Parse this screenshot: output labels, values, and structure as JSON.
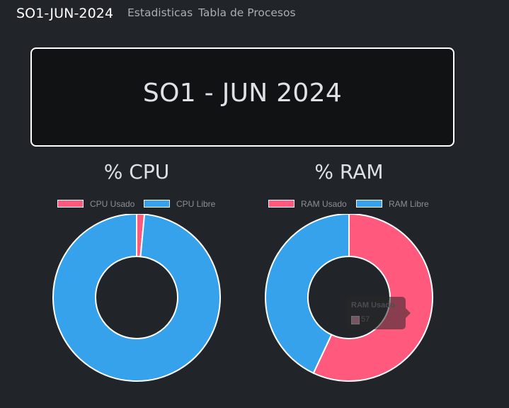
{
  "nav": {
    "brand": "SO1-JUN-2024",
    "links": [
      "Estadisticas",
      "Tabla de Procesos"
    ]
  },
  "banner": {
    "title": "SO1 - JUN 2024"
  },
  "colors": {
    "used": "#ff5a7e",
    "free": "#36a2eb",
    "background": "#212529"
  },
  "chart_data": [
    {
      "type": "pie",
      "title": "% CPU",
      "legend_position": "top",
      "series": [
        {
          "name": "CPU Usado",
          "value": 1.5,
          "color": "#ff5a7e"
        },
        {
          "name": "CPU Libre",
          "value": 98.5,
          "color": "#36a2eb"
        }
      ]
    },
    {
      "type": "pie",
      "title": "% RAM",
      "legend_position": "top",
      "series": [
        {
          "name": "RAM Usado",
          "value": 57,
          "color": "#ff5a7e"
        },
        {
          "name": "RAM Libre",
          "value": 43,
          "color": "#36a2eb"
        }
      ],
      "tooltip": {
        "title": "RAM Usado",
        "value": "57"
      }
    }
  ]
}
